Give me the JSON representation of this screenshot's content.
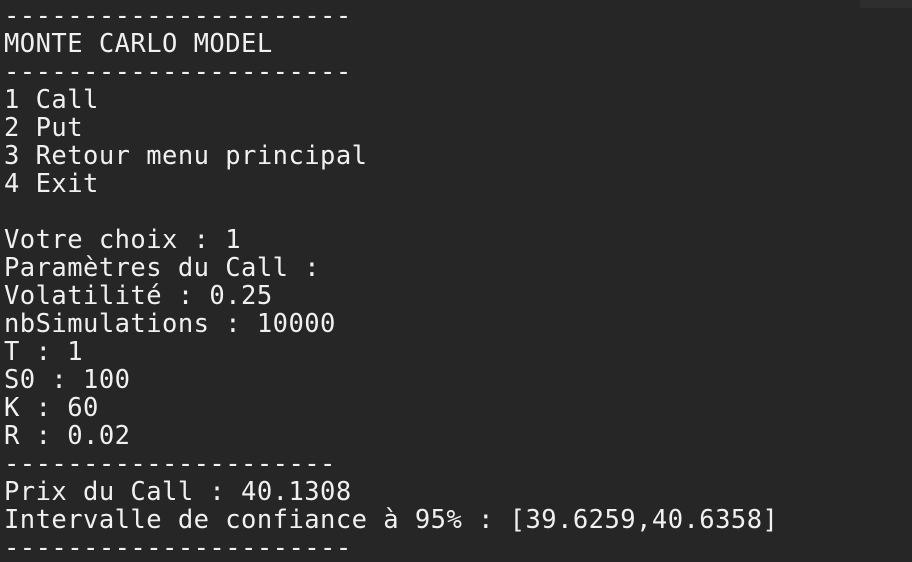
{
  "terminal": {
    "rule_long": "----------------------",
    "rule_short": "---------------------",
    "title": "MONTE CARLO MODEL",
    "menu": [
      "1 Call",
      "2 Put",
      "3 Retour menu principal",
      "4 Exit"
    ],
    "prompt": "Votre choix : 1",
    "params_header": "Paramètres du Call :",
    "params": [
      "Volatilité : 0.25",
      "nbSimulations : 10000",
      "T : 1",
      "S0 : 100",
      "K : 60",
      "R : 0.02"
    ],
    "result_price": "Prix du Call : 40.1308",
    "result_interval": "Intervalle de confiance à 95% : [39.6259,40.6358]"
  }
}
